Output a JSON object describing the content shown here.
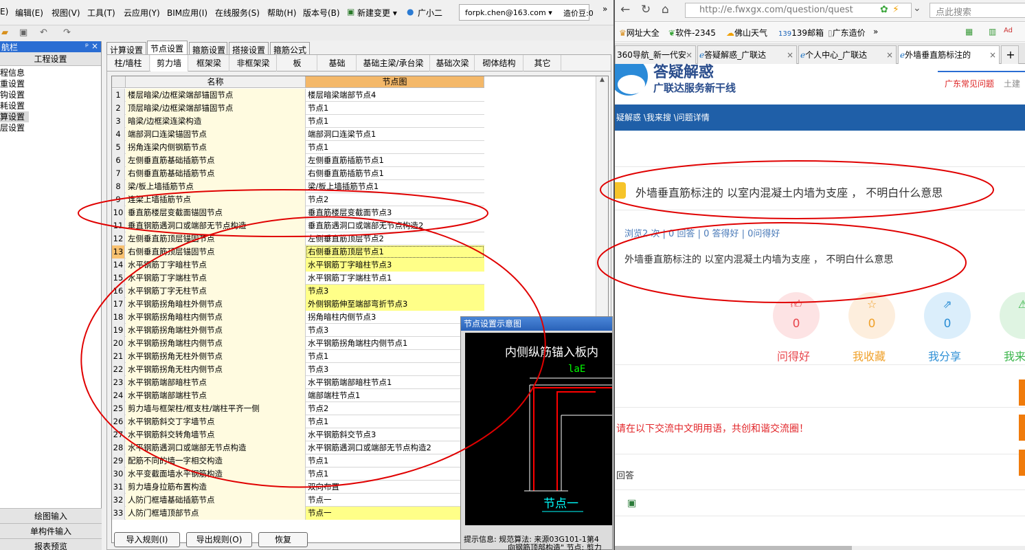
{
  "app": {
    "menu": [
      "E) 编辑(E)",
      "视图(V)",
      "工具(T)",
      "云应用(Y)",
      "BIM应用(I)",
      "在线服务(S)",
      "帮助(H)",
      "版本号(B)",
      "新建变更",
      "广小二"
    ],
    "menu_raw": [
      "E)",
      "编辑(E)",
      "视图(V)",
      "工具(T)",
      "云应用(Y)",
      "BIM应用(I)",
      "在线服务(S)",
      "帮助(H)",
      "版本号(B)",
      "新建变更 ▾",
      "广小二"
    ],
    "email": "forpk.chen@163.com ▾",
    "price_bean": "造价豆:0",
    "expand": "»"
  },
  "nav": {
    "title": "航栏",
    "pin": "ᵖ ×",
    "section": "工程设置",
    "items": [
      "程信息",
      "重设置",
      "钩设置",
      "耗设置",
      "算设置",
      "层设置"
    ],
    "bottom": [
      "绘图输入",
      "单构件输入",
      "报表预览"
    ]
  },
  "tabs_top": [
    "计算设置",
    "节点设置",
    "箍筋设置",
    "搭接设置",
    "箍筋公式"
  ],
  "tabs_sub": [
    "柱/墙柱",
    "剪力墙",
    "框架梁",
    "非框架梁",
    "板",
    "基础",
    "基础主梁/承台梁",
    "基础次梁",
    "砌体结构",
    "其它"
  ],
  "grid": {
    "col_name": "名称",
    "col_node": "节点图",
    "rows": [
      {
        "n": "1",
        "name": "楼层暗梁/边框梁端部锚固节点",
        "node": "楼层暗梁端部节点4",
        "hl": false
      },
      {
        "n": "2",
        "name": "顶层暗梁/边框梁端部锚固节点",
        "node": "节点1",
        "hl": false
      },
      {
        "n": "3",
        "name": "暗梁/边框梁连梁构造",
        "node": "节点1",
        "hl": false
      },
      {
        "n": "4",
        "name": "端部洞口连梁锚固节点",
        "node": "端部洞口连梁节点1",
        "hl": false
      },
      {
        "n": "5",
        "name": "拐角连梁内侧钢筋节点",
        "node": "节点1",
        "hl": false
      },
      {
        "n": "6",
        "name": "左侧垂直筋基础插筋节点",
        "node": "左侧垂直筋插筋节点1",
        "hl": false
      },
      {
        "n": "7",
        "name": "右侧垂直筋基础插筋节点",
        "node": "右侧垂直筋插筋节点1",
        "hl": false
      },
      {
        "n": "8",
        "name": "梁/板上墙插筋节点",
        "node": "梁/板上墙插筋节点1",
        "hl": false
      },
      {
        "n": "9",
        "name": "连梁上墙插筋节点",
        "node": "节点2",
        "hl": false
      },
      {
        "n": "10",
        "name": "垂直筋楼层变截面锚固节点",
        "node": "垂直筋楼层变截面节点3",
        "hl": false
      },
      {
        "n": "11",
        "name": "垂直钢筋遇洞口或端部无节点构造",
        "node": "垂直筋遇洞口或端部无节点构造2",
        "hl": false
      },
      {
        "n": "12",
        "name": "左侧垂直筋顶层锚固节点",
        "node": "左侧垂直筋顶层节点2",
        "hl": false
      },
      {
        "n": "13",
        "name": "右侧垂直筋顶层锚固节点",
        "node": "右侧垂直筋顶层节点1",
        "hl": "sel"
      },
      {
        "n": "14",
        "name": "水平钢筋丁字暗柱节点",
        "node": "水平钢筋丁字暗柱节点3",
        "hl": true
      },
      {
        "n": "15",
        "name": "水平钢筋丁字端柱节点",
        "node": "水平钢筋丁字端柱节点1",
        "hl": false
      },
      {
        "n": "16",
        "name": "水平钢筋丁字无柱节点",
        "node": "节点3",
        "hl": true
      },
      {
        "n": "17",
        "name": "水平钢筋拐角暗柱外侧节点",
        "node": "外侧钢筋伸至端部弯折节点3",
        "hl": true
      },
      {
        "n": "18",
        "name": "水平钢筋拐角暗柱内侧节点",
        "node": "拐角暗柱内侧节点3",
        "hl": false
      },
      {
        "n": "19",
        "name": "水平钢筋拐角端柱外侧节点",
        "node": "节点3",
        "hl": false
      },
      {
        "n": "20",
        "name": "水平钢筋拐角端柱内侧节点",
        "node": "水平钢筋拐角端柱内侧节点1",
        "hl": false
      },
      {
        "n": "21",
        "name": "水平钢筋拐角无柱外侧节点",
        "node": "节点1",
        "hl": false
      },
      {
        "n": "22",
        "name": "水平钢筋拐角无柱内侧节点",
        "node": "节点3",
        "hl": false
      },
      {
        "n": "23",
        "name": "水平钢筋端部暗柱节点",
        "node": "水平钢筋端部暗柱节点1",
        "hl": false
      },
      {
        "n": "24",
        "name": "水平钢筋端部端柱节点",
        "node": "端部端柱节点1",
        "hl": false
      },
      {
        "n": "25",
        "name": "剪力墙与框架柱/框支柱/端柱平齐一侧",
        "node": "节点2",
        "hl": false
      },
      {
        "n": "26",
        "name": "水平钢筋斜交丁字墙节点",
        "node": "节点1",
        "hl": false
      },
      {
        "n": "27",
        "name": "水平钢筋斜交转角墙节点",
        "node": "水平钢筋斜交节点3",
        "hl": false
      },
      {
        "n": "28",
        "name": "水平钢筋遇洞口或端部无节点构造",
        "node": "水平钢筋遇洞口或端部无节点构造2",
        "hl": false
      },
      {
        "n": "29",
        "name": "配筋不同的墙一字相交构造",
        "node": "节点1",
        "hl": false
      },
      {
        "n": "30",
        "name": "水平变截面墙水平钢筋构造",
        "node": "节点1",
        "hl": false
      },
      {
        "n": "31",
        "name": "剪力墙身拉筋布置构造",
        "node": "双向布置",
        "hl": false
      },
      {
        "n": "32",
        "name": "人防门框墙基础插筋节点",
        "node": "节点一",
        "hl": false
      },
      {
        "n": "33",
        "name": "人防门框墙顶部节点",
        "node": "节点一",
        "hl": true
      }
    ]
  },
  "buttons": {
    "import": "导入规则(I)",
    "export": "导出规则(O)",
    "restore": "恢复"
  },
  "diagram": {
    "title": "节点设置示意图",
    "caption": "内侧纵筋锚入板内",
    "lae": "laE",
    "node_label": "节点一",
    "hint1": "提示信息: 规范算法: 来源03G101-1第4",
    "hint2": "向钢筋顶部构造\" 节点: 剪力"
  },
  "browser": {
    "url": "http://e.fwxgx.com/question/quest",
    "search_placeholder": "点此搜索",
    "bookmarks": [
      "网址大全",
      "软件-2345",
      "佛山天气",
      "139邮箱",
      "广东造价"
    ],
    "bm_more": "»",
    "tabs": [
      "360导航_新一代安",
      "答疑解惑_广联达",
      "个人中心_广联达",
      "外墙垂直筋标注的"
    ],
    "new_tab": "+",
    "site_title": "答疑解惑",
    "site_sub": "广联达服务新干线",
    "header_links": [
      "广东常见问题",
      "土建"
    ],
    "breadcrumb": "疑解惑 \\我来搜 \\问题详情",
    "question_title": "外墙垂直筋标注的 以室内混凝土内墙为支座 ， 不明白什么意思",
    "stats": "浏览2 次 | 0 回答 | 0 答得好 | 0问得好",
    "question_body": "外墙垂直筋标注的  以室内混凝土内墙为支座 ， 不明白什么意思",
    "actions": [
      {
        "label": "问得好",
        "count": "0",
        "color": "#e8474d",
        "bg": "#fde3e4"
      },
      {
        "label": "我收藏",
        "count": "0",
        "color": "#f0a12a",
        "bg": "#fdeedd"
      },
      {
        "label": "我分享",
        "count": "0",
        "color": "#2d8fd5",
        "bg": "#dbeefb"
      },
      {
        "label": "我来",
        "count": "",
        "color": "#3ab54a",
        "bg": "#dff4e2"
      }
    ],
    "notice": "请在以下交流中文明用语，共创和谐交流圈！",
    "answer_label": "回答"
  },
  "colors": {
    "annotation": "#e00000",
    "accent": "#1f5fa8"
  }
}
